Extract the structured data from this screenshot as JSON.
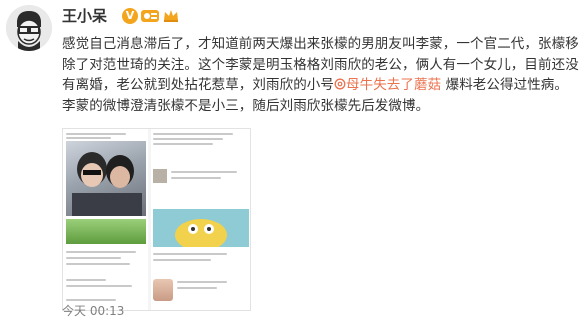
{
  "post": {
    "username": "王小呆",
    "verified_badge": "V",
    "avatar_icon": "cartoon-glasses-avatar",
    "text_before_mention": "感觉自己消息滞后了，才知道前两天爆出来张檬的男朋友叫李蒙，一个官二代，张檬移除了对范世琦的关注。这个李蒙是明玉格格刘雨欣的老公，俩人有一个女儿，目前还没有离婚，老公就到处拈花惹草，刘雨欣的小号",
    "mention_text": "母牛失去了蘑菇",
    "text_after_mention": " 爆料老公得过性病。李蒙的微博澄清张檬不是小三，随后刘雨欣张檬先后发微博。",
    "timestamp": "今天 00:13",
    "colors": {
      "mention": "#eb7350",
      "badge": "#f3a51d",
      "timestamp": "#808080"
    }
  }
}
